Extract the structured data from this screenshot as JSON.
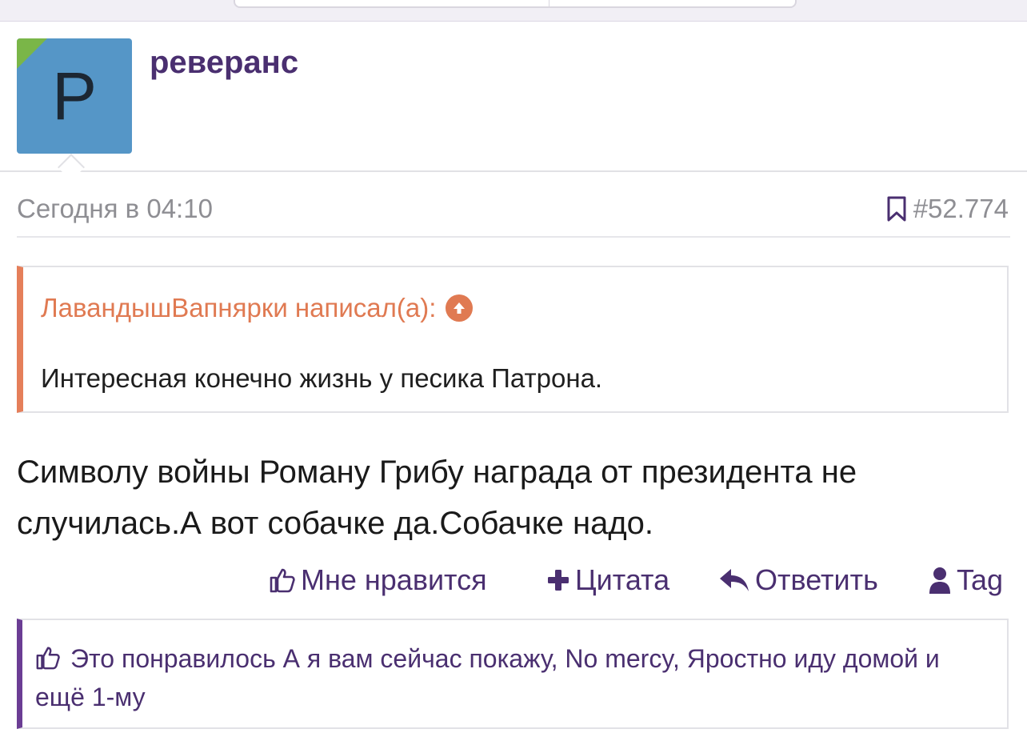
{
  "post": {
    "avatar_letter": "P",
    "username": "реверанс",
    "date": "Сегодня в 04:10",
    "post_number": "#52.774",
    "quote": {
      "author": "ЛавандышВапнярки написал(а):",
      "text": "Интересная конечно жизнь у песика Патрона."
    },
    "body": "Символу войны Роману Грибу награда от президента не случилась.А вот собачке да.Собачке надо.",
    "actions": {
      "like": "Мне нравится",
      "quote": "Цитата",
      "reply": "Ответить",
      "tag": "Tag"
    },
    "likes_text": "Это понравилось А я вам сейчас покажу, No mercy, Яростно иду домой и ещё 1-му"
  },
  "colors": {
    "accent": "#4a2f70",
    "quote_accent": "#e07a52",
    "avatar_bg": "#5596c7",
    "muted": "#8e8e93"
  },
  "icons": {
    "like": "thumbs-up-icon",
    "quote": "plus-icon",
    "reply": "reply-icon",
    "tag": "user-icon",
    "bookmark": "bookmark-icon",
    "quote_jump": "arrow-up-circle-icon"
  }
}
